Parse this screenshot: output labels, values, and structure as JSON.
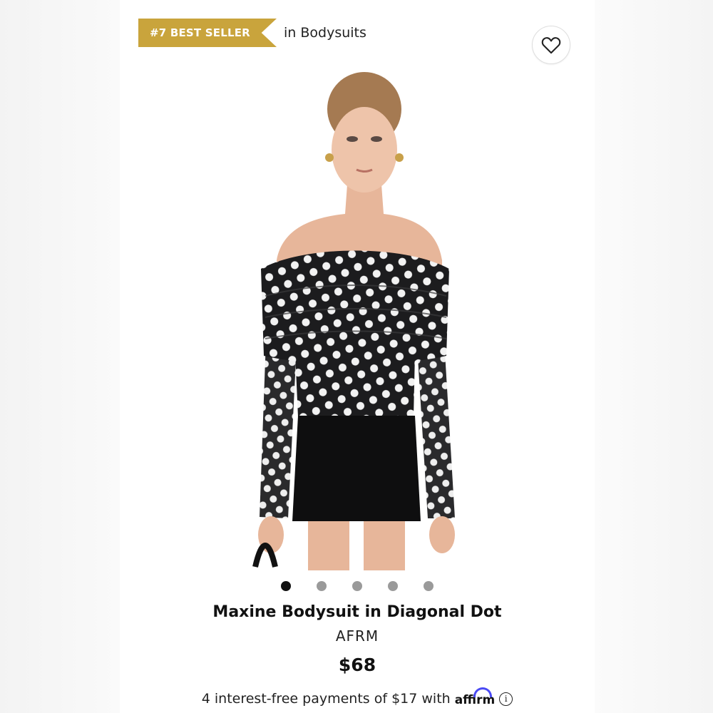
{
  "badge": {
    "label": "#7 BEST SELLER",
    "context": "in Bodysuits",
    "color": "#c9a43c"
  },
  "wishlist": {
    "icon": "heart-icon"
  },
  "gallery": {
    "total_images": 5,
    "active_index": 0
  },
  "product": {
    "title": "Maxine Bodysuit in Diagonal Dot",
    "brand": "AFRM",
    "price": "$68"
  },
  "payments": {
    "text": "4 interest-free payments of $17 with",
    "provider": "affirm",
    "provider_color": "#4a4af4",
    "info_icon": "info-icon"
  }
}
